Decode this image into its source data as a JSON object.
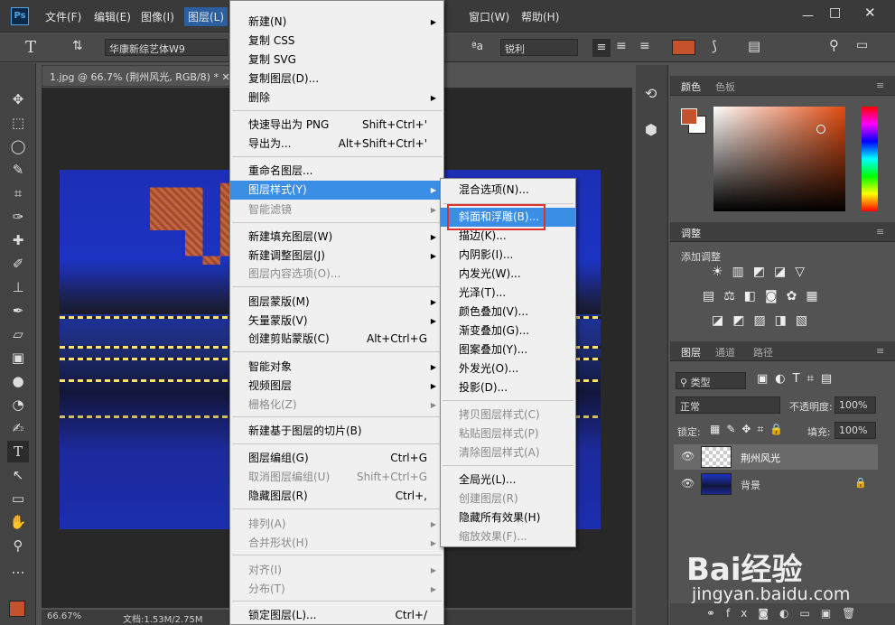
{
  "app": {
    "logo": "Ps"
  },
  "menubar": {
    "items": [
      "文件(F)",
      "编辑(E)",
      "图像(I)",
      "图层(L)",
      "窗口(W)",
      "帮助(H)"
    ]
  },
  "options": {
    "font_family": "华康新综艺体W9",
    "antialias": "锐利",
    "text_color": "#c4522a"
  },
  "document": {
    "tab_title": "1.jpg @ 66.7% (荆州风光, RGB/8) *",
    "zoom": "66.67%",
    "doc_size": "文档:1.53M/2.75M"
  },
  "layer_menu": {
    "items": [
      {
        "label": "新建(N)",
        "enabled": true,
        "arrow": true
      },
      {
        "label": "复制 CSS",
        "enabled": true
      },
      {
        "label": "复制 SVG",
        "enabled": true
      },
      {
        "label": "复制图层(D)...",
        "enabled": true
      },
      {
        "label": "删除",
        "enabled": true,
        "arrow": true
      },
      {
        "label": "快速导出为 PNG",
        "shortcut": "Shift+Ctrl+'",
        "enabled": true
      },
      {
        "label": "导出为...",
        "shortcut": "Alt+Shift+Ctrl+'",
        "enabled": true
      },
      {
        "label": "重命名图层...",
        "enabled": true
      },
      {
        "label": "图层样式(Y)",
        "enabled": true,
        "arrow": true
      },
      {
        "label": "智能滤镜",
        "enabled": false,
        "arrow": true
      },
      {
        "label": "新建填充图层(W)",
        "enabled": true,
        "arrow": true
      },
      {
        "label": "新建调整图层(J)",
        "enabled": true,
        "arrow": true
      },
      {
        "label": "图层内容选项(O)...",
        "enabled": false
      },
      {
        "label": "图层蒙版(M)",
        "enabled": true,
        "arrow": true
      },
      {
        "label": "矢量蒙版(V)",
        "enabled": true,
        "arrow": true
      },
      {
        "label": "创建剪贴蒙版(C)",
        "shortcut": "Alt+Ctrl+G",
        "enabled": true
      },
      {
        "label": "智能对象",
        "enabled": true,
        "arrow": true
      },
      {
        "label": "视频图层",
        "enabled": true,
        "arrow": true
      },
      {
        "label": "栅格化(Z)",
        "enabled": false,
        "arrow": true
      },
      {
        "label": "新建基于图层的切片(B)",
        "enabled": true
      },
      {
        "label": "图层编组(G)",
        "shortcut": "Ctrl+G",
        "enabled": true
      },
      {
        "label": "取消图层编组(U)",
        "shortcut": "Shift+Ctrl+G",
        "enabled": false
      },
      {
        "label": "隐藏图层(R)",
        "shortcut": "Ctrl+,",
        "enabled": true
      },
      {
        "label": "排列(A)",
        "enabled": false,
        "arrow": true
      },
      {
        "label": "合并形状(H)",
        "enabled": false,
        "arrow": true
      },
      {
        "label": "对齐(I)",
        "enabled": false,
        "arrow": true
      },
      {
        "label": "分布(T)",
        "enabled": false,
        "arrow": true
      },
      {
        "label": "锁定图层(L)...",
        "shortcut": "Ctrl+/",
        "enabled": true
      }
    ]
  },
  "style_submenu": {
    "items": [
      {
        "label": "混合选项(N)...",
        "enabled": true
      },
      {
        "label": "斜面和浮雕(B)...",
        "enabled": true
      },
      {
        "label": "描边(K)...",
        "enabled": true
      },
      {
        "label": "内阴影(I)...",
        "enabled": true
      },
      {
        "label": "内发光(W)...",
        "enabled": true
      },
      {
        "label": "光泽(T)...",
        "enabled": true
      },
      {
        "label": "颜色叠加(V)...",
        "enabled": true
      },
      {
        "label": "渐变叠加(G)...",
        "enabled": true
      },
      {
        "label": "图案叠加(Y)...",
        "enabled": true
      },
      {
        "label": "外发光(O)...",
        "enabled": true
      },
      {
        "label": "投影(D)...",
        "enabled": true
      },
      {
        "label": "拷贝图层样式(C)",
        "enabled": false
      },
      {
        "label": "粘贴图层样式(P)",
        "enabled": false
      },
      {
        "label": "清除图层样式(A)",
        "enabled": false
      },
      {
        "label": "全局光(L)...",
        "enabled": true
      },
      {
        "label": "创建图层(R)",
        "enabled": false
      },
      {
        "label": "隐藏所有效果(H)",
        "enabled": true
      },
      {
        "label": "缩放效果(F)...",
        "enabled": false
      }
    ]
  },
  "color_panel": {
    "tabs": [
      "颜色",
      "色板"
    ],
    "foreground": "#c4522a",
    "background": "#ffffff"
  },
  "adjust_panel": {
    "tab": "调整",
    "subtitle": "添加调整"
  },
  "layers_panel": {
    "tabs": [
      "图层",
      "通道",
      "路径"
    ],
    "filter": "类型",
    "blend_mode": "正常",
    "opacity_label": "不透明度:",
    "opacity": "100%",
    "lock_label": "锁定:",
    "fill_label": "填充:",
    "fill": "100%",
    "layers": [
      {
        "name": "荆州风光",
        "selected": true,
        "locked": false
      },
      {
        "name": "背景",
        "selected": false,
        "locked": true
      }
    ]
  },
  "watermark": {
    "brand": "Bai经验",
    "url": "jingyan.baidu.com"
  }
}
